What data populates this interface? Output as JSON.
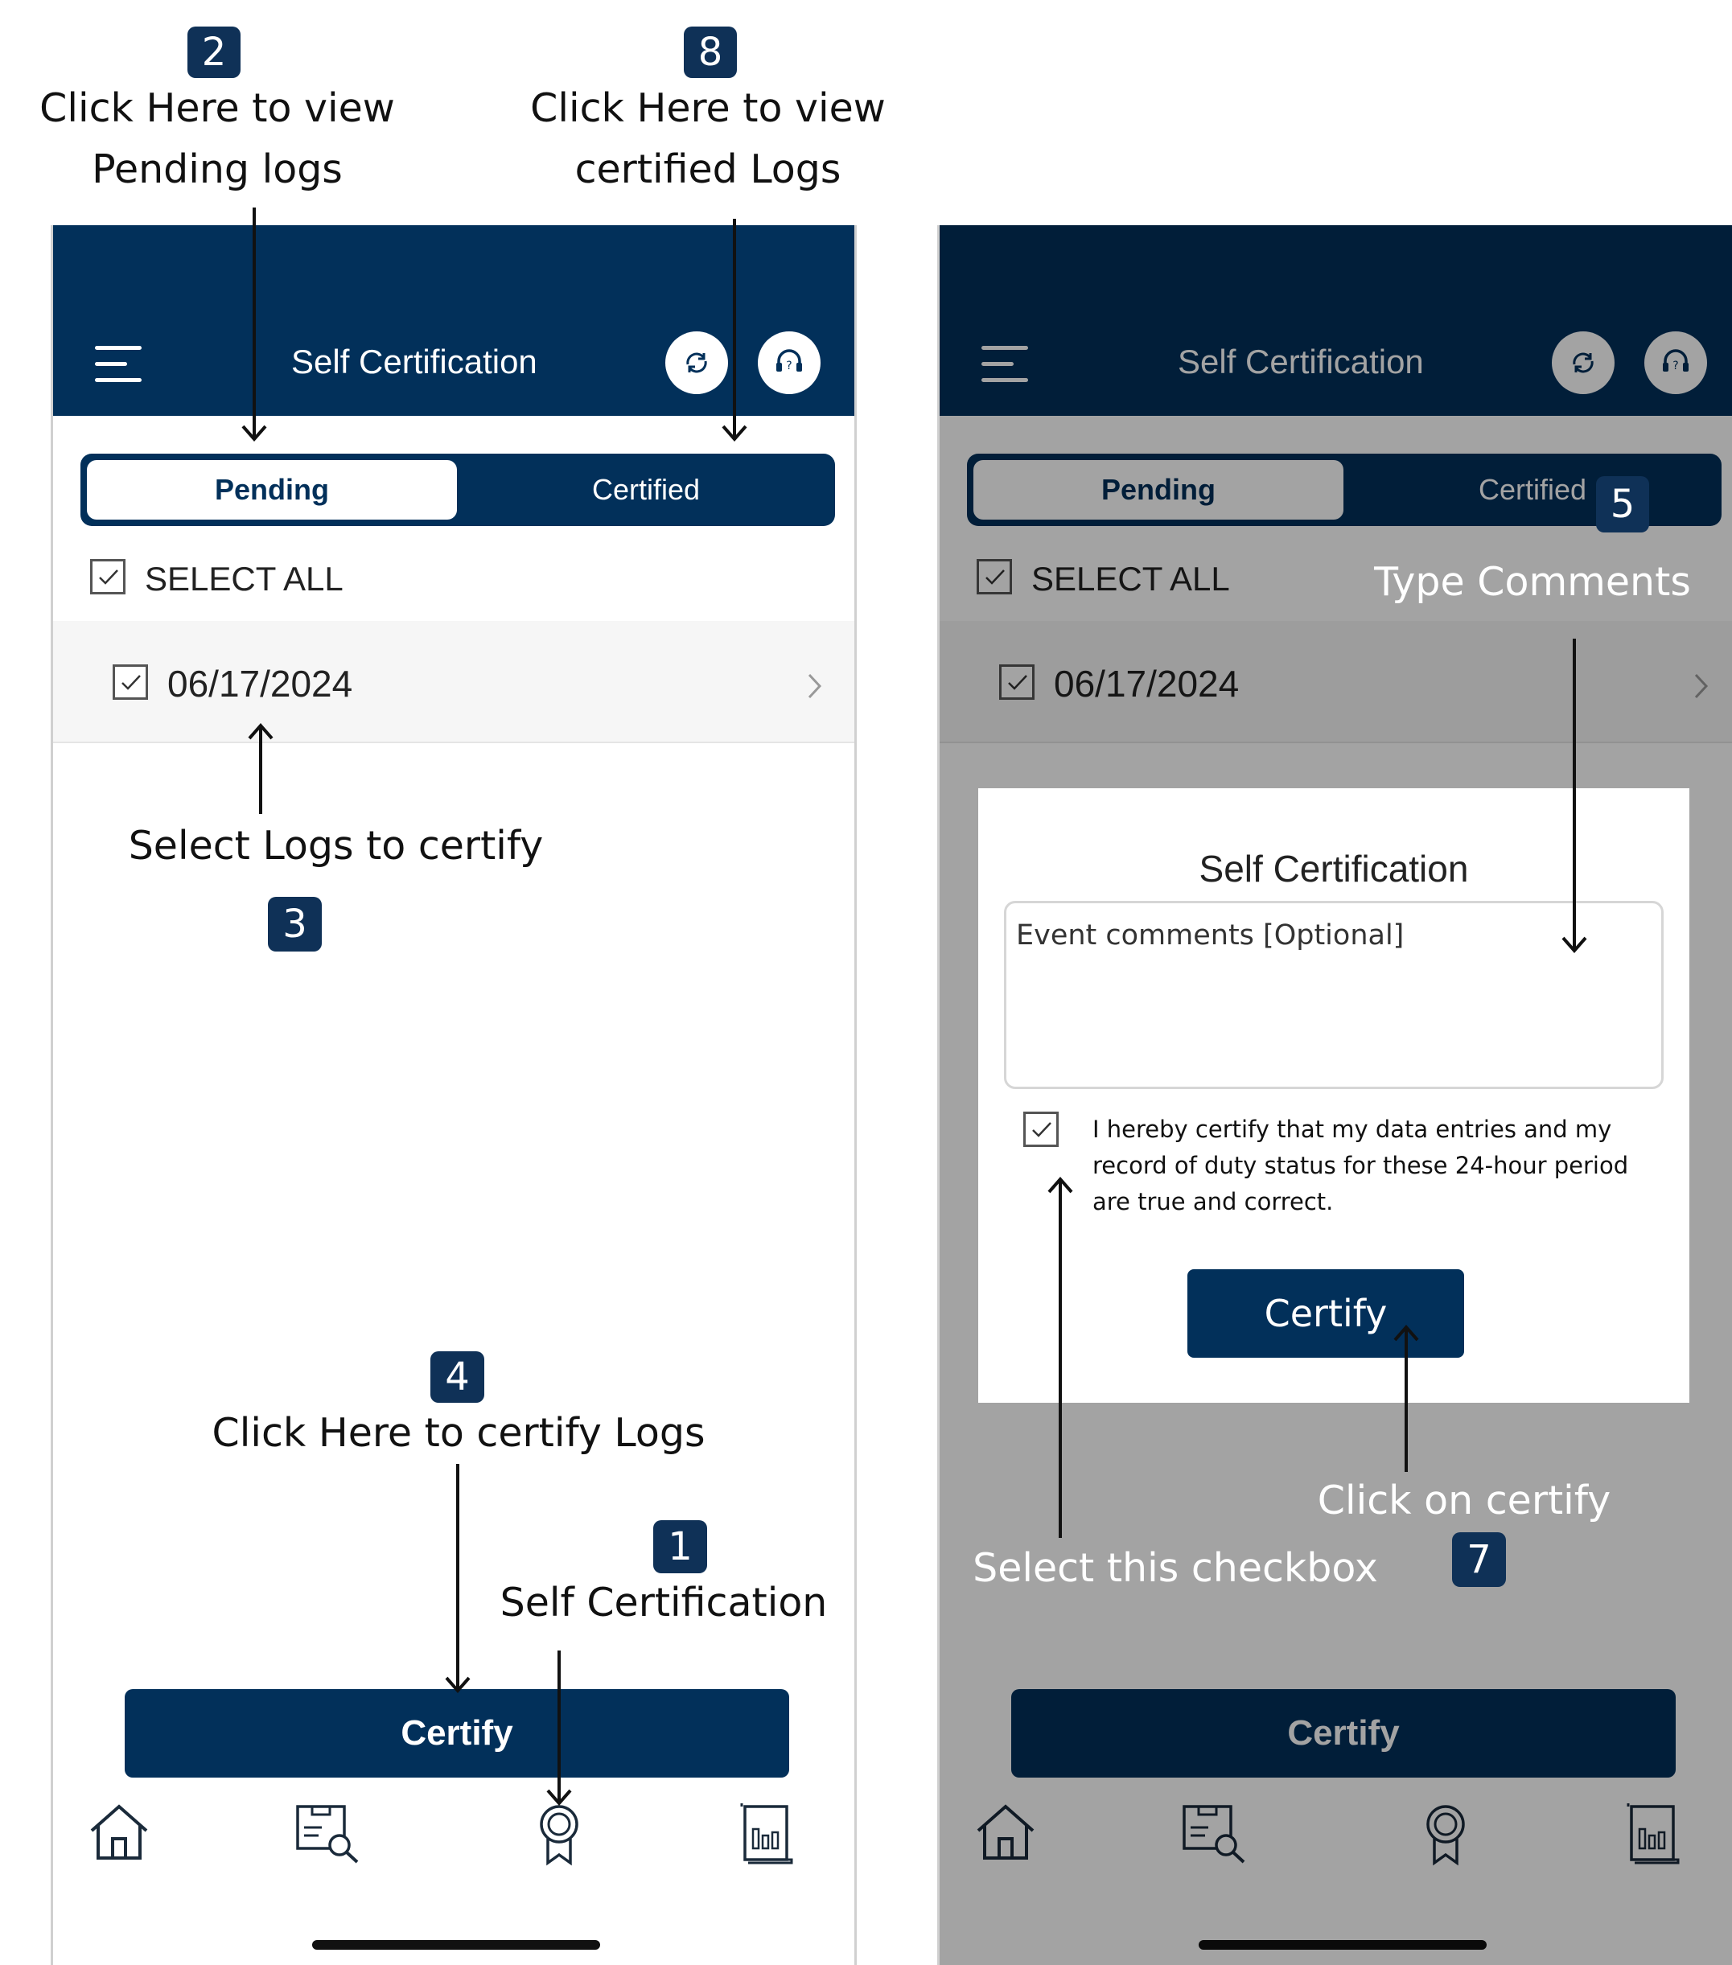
{
  "annotations": {
    "view_pending": {
      "badge": "2",
      "line1": "Click Here to view",
      "line2": "Pending logs"
    },
    "view_certified": {
      "badge": "8",
      "line1": "Click Here to view",
      "line2": "certified Logs"
    },
    "select_logs": {
      "text": "Select Logs to certify",
      "badge": "3"
    },
    "certify_logs": {
      "badge": "4",
      "text": "Click Here to certify Logs"
    },
    "self_cert": {
      "badge": "1",
      "text": "Self Certification"
    },
    "type_comments": {
      "badge": "5",
      "text": "Type Comments"
    },
    "click_certify": {
      "text": "Click on certify",
      "badge": "7"
    },
    "select_checkbox": {
      "text": "Select this checkbox"
    }
  },
  "app": {
    "title": "Self Certification",
    "tabs": {
      "pending": "Pending",
      "certified": "Certified"
    },
    "select_all": "SELECT ALL",
    "log_date": "06/17/2024",
    "certify_button": "Certify",
    "header_icons": [
      "refresh-icon",
      "support-headset-icon"
    ],
    "nav_icons": [
      "home-icon",
      "log-search-icon",
      "certification-badge-icon",
      "report-chart-icon"
    ]
  },
  "modal": {
    "title": "Self Certification",
    "comments_placeholder": "Event comments [Optional]",
    "certification_text": "I hereby certify that my data entries and my record of duty status for these 24-hour period are true and correct.",
    "certify_button": "Certify"
  },
  "colors": {
    "primary_navy": "#02305a",
    "badge_navy": "#0f3157",
    "dim_overlay": "rgba(0,0,0,0.36)"
  }
}
